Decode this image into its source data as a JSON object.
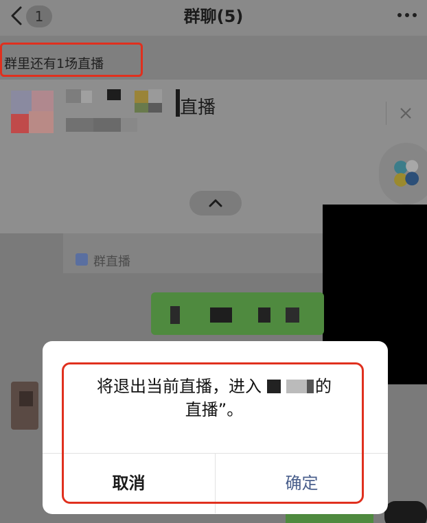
{
  "header": {
    "back_badge": "1",
    "title": "群聊(5)"
  },
  "live_notice": "群里还有1场直播",
  "live_card": {
    "name": "直播"
  },
  "chat": {
    "group_live_label": "群直播"
  },
  "dialog": {
    "message_line1": "将退出当前直播，进入",
    "message_line1_end": "的",
    "message_line2": "直播”。",
    "cancel_label": "取消",
    "confirm_label": "确定"
  },
  "colors": {
    "highlight": "#e0301e",
    "confirm_text": "#4a5f8c"
  }
}
